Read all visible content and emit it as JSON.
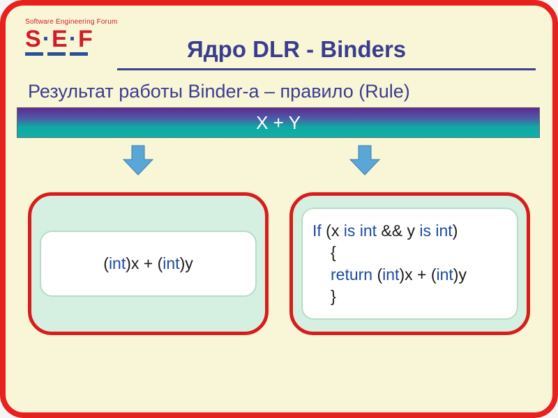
{
  "logo": {
    "small": "Software Engineering Forum",
    "main_s": "S",
    "main_e": "E",
    "main_f": "F",
    "dot": "·"
  },
  "title": "Ядро DLR - Binders",
  "subtitle": "Результат работы Binder-а – правило (Rule)",
  "expression": "X + Y",
  "box_left": {
    "lp1": "(",
    "int1": "int",
    "mid1": ")x + (",
    "int2": "int",
    "rp1": ")y"
  },
  "box_right": {
    "if": "If",
    "cond_open": "  (x ",
    "is1": "is int",
    "cond_mid": " && y ",
    "is2": "is int",
    "cond_close": ")",
    "brace_open": "{",
    "ret": "return",
    "ret_open": " (",
    "int1": "int",
    "ret_mid": ")x + (",
    "int2": "int",
    "ret_close": ")y",
    "brace_close": "}"
  }
}
